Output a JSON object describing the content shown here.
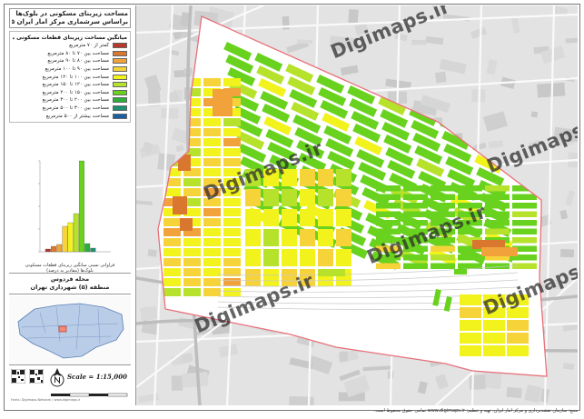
{
  "title": {
    "line1": "مساحت زیربنای مسکونی در بلوک‌ها",
    "line2": "براساس سرشماری مرکز آمار ایران ۱۳۹۵"
  },
  "legend": {
    "heading": "میانگین مساحت زیربنای قطعات مسکونی بلوک‌ها",
    "items": [
      {
        "label": "کمتر از ۷۰ مترمربع",
        "color": "#b5382a"
      },
      {
        "label": "مساحت بین ۷۰ تا ۸۰ مترمربع",
        "color": "#d9772e"
      },
      {
        "label": "مساحت بین ۸۰ تا ۹۰ مترمربع",
        "color": "#f2a23a"
      },
      {
        "label": "مساحت بین ۹۰ تا ۱۰۰ مترمربع",
        "color": "#f7d33a"
      },
      {
        "label": "مساحت بین ۱۰۰ تا ۱۲۰ مترمربع",
        "color": "#f2f21c"
      },
      {
        "label": "مساحت بین ۱۲۰ تا ۱۵۰ مترمربع",
        "color": "#b6e22c"
      },
      {
        "label": "مساحت بین ۱۵۰ تا ۲۰۰ مترمربع",
        "color": "#68d21e"
      },
      {
        "label": "مساحت بین ۲۰۰ تا ۳۰۰ مترمربع",
        "color": "#2cae3a"
      },
      {
        "label": "مساحت بین ۳۰۰ تا ۵۰۰ مترمربع",
        "color": "#1f8f73"
      },
      {
        "label": "مساحت بیشتر از ۵۰۰ مترمربع",
        "color": "#1c5fa0"
      }
    ]
  },
  "histogram": {
    "caption_line1": "فراوانی نسبی میانگین زیربنای قطعات مسکونی",
    "caption_line2": "بلوک‌ها (مقادیر به درصد)",
    "values": [
      3,
      6,
      8,
      28,
      32,
      42,
      100,
      9,
      4,
      0
    ]
  },
  "area": {
    "name": "محله فردوس",
    "district": "منطقه (۵) شهرداری تهران"
  },
  "scale": {
    "text": "Scale = 1:15,000"
  },
  "footer_credit_left": "Fonts: Digimaps-Network / www.digimaps.ir",
  "footer_credit": "منبع: سازمان نقشه‌برداری و مرکز آمار ایران. تهیه و تنظیم: www.digimaps.ir تمامی حقوق محفوظ است.",
  "watermark": {
    "text": "Digimaps.ir"
  }
}
